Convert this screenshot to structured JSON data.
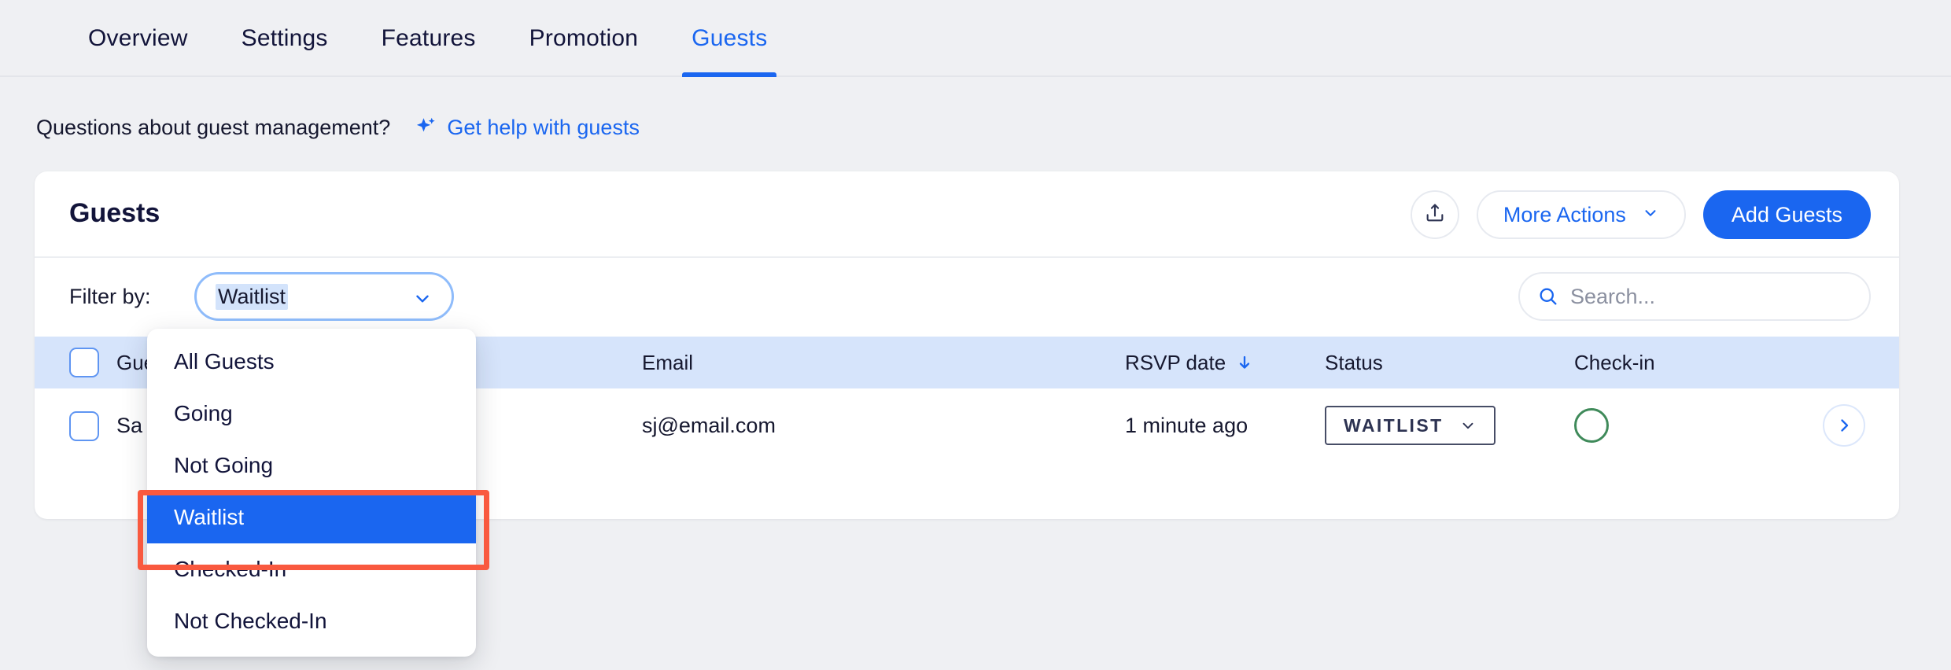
{
  "tabs": [
    {
      "label": "Overview",
      "active": false
    },
    {
      "label": "Settings",
      "active": false
    },
    {
      "label": "Features",
      "active": false
    },
    {
      "label": "Promotion",
      "active": false
    },
    {
      "label": "Guests",
      "active": true
    }
  ],
  "help": {
    "question": "Questions about guest management?",
    "link": "Get help with guests",
    "icon": "sparkle-icon"
  },
  "card": {
    "title": "Guests",
    "actions": {
      "export_icon": "upload-icon",
      "more_actions": "More Actions",
      "more_actions_caret": "chevron-down-icon",
      "add_guests": "Add Guests"
    }
  },
  "filter": {
    "label": "Filter by:",
    "selected": "Waitlist",
    "caret": "chevron-down-icon",
    "options": [
      "All Guests",
      "Going",
      "Not Going",
      "Waitlist",
      "Checked-In",
      "Not Checked-In"
    ],
    "highlighted_option": "Waitlist"
  },
  "search": {
    "placeholder": "Search...",
    "value": "",
    "icon": "search-icon"
  },
  "table": {
    "columns": [
      {
        "label": "Guest",
        "sorted": false
      },
      {
        "label": "Email",
        "sorted": false
      },
      {
        "label": "RSVP date",
        "sorted": true,
        "sort_icon": "arrow-down-icon"
      },
      {
        "label": "Status",
        "sorted": false
      },
      {
        "label": "Check-in",
        "sorted": false
      }
    ],
    "rows": [
      {
        "guest": "Sa",
        "email": "sj@email.com",
        "rsvp_date": "1 minute ago",
        "status": "WAITLIST",
        "status_caret": "chevron-down-icon",
        "checkin": "not-checked-in",
        "chevron": "chevron-right-icon"
      }
    ]
  },
  "colors": {
    "accent": "#1a66f0",
    "page_bg": "#eff0f3",
    "table_header_bg": "#d6e4fb",
    "highlight_box": "#f9593f",
    "checkin_ring": "#3f8a5a"
  }
}
